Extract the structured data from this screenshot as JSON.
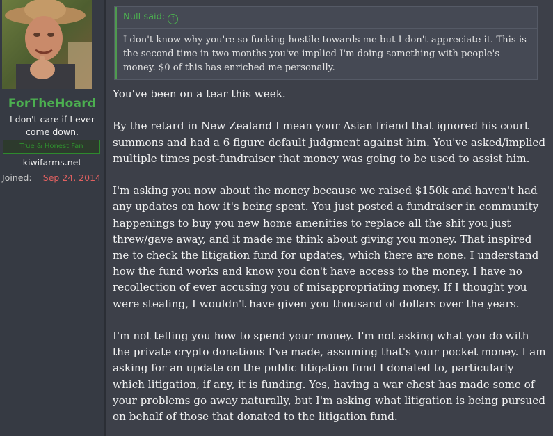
{
  "user": {
    "name": "ForTheHoard",
    "title": "I don't care if I ever come down.",
    "banner": "True & Honest Fan",
    "site": "kiwifarms.net",
    "joined_label": "Joined:",
    "joined_date": "Sep 24, 2014"
  },
  "quote": {
    "author": "Null said:",
    "icon": "arrow-up-icon",
    "text": "I don't know why you're so fucking hostile towards me but I don't appreciate it. This is the second time in two months you've implied I'm doing something with people's money. $0 of this has enriched me personally."
  },
  "post": {
    "paragraphs": [
      "You've been on a tear this week.",
      "By the retard in New Zealand I mean your Asian friend that ignored his court summons and had a 6 figure default judgment against him. You've asked/implied multiple times post-fundraiser that money was going to be used to assist him.",
      "I'm asking you now about the money because we raised $150k and haven't had any updates on how it's being spent. You just posted a fundraiser in community happenings to buy you new home amenities to replace all the shit you just threw/gave away, and it made me think about giving you money. That inspired me to check the litigation fund for updates, which there are none. I understand how the fund works and know you don't have access to the money. I have no recollection of ever accusing you of misappropriating money. If I thought you were stealing, I wouldn't have given you thousand of dollars over the years.",
      "I'm not telling you how to spend your money. I'm not asking what you do with the private crypto donations I've made, assuming that's your pocket money. I am asking for an update on the public litigation fund I donated to, particularly which litigation, if any, it is funding. Yes, having a war chest has made some of your problems go away naturally, but I'm asking what litigation is being pursued on behalf of those that donated to the litigation fund."
    ]
  },
  "colors": {
    "username": "#4caf50",
    "joined_date": "#e06060",
    "quote_border": "#4f9a4f"
  }
}
